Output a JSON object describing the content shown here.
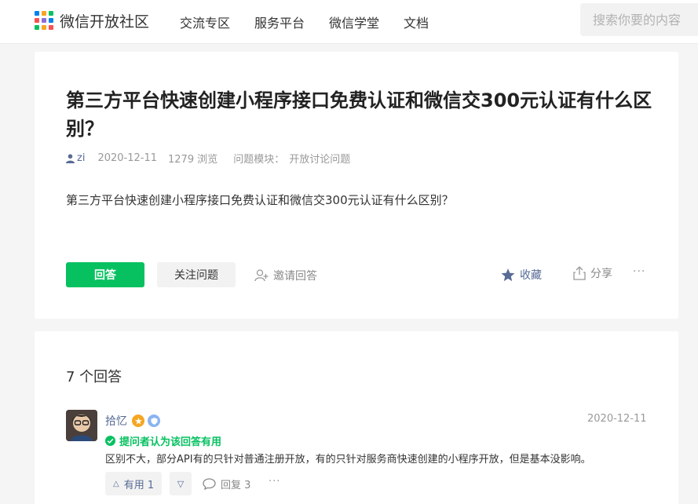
{
  "header": {
    "logo_text": "微信开放社区",
    "nav": [
      "交流专区",
      "服务平台",
      "微信学堂",
      "文档"
    ],
    "search_placeholder": "搜索你要的内容",
    "logo_colors": [
      "#0082ef",
      "#f5a623",
      "#07c160",
      "#fa5151",
      "#8a6dd9",
      "#0082ef",
      "#07c160",
      "#f5a623",
      "#fa5151"
    ]
  },
  "question": {
    "title": "第三方平台快速创建小程序接口免费认证和微信交300元认证有什么区别？",
    "author": "zi",
    "date": "2020-12-11",
    "views": "1279 浏览",
    "module_label": "问题模块：",
    "module_value": "开放讨论问题",
    "body": "第三方平台快速创建小程序接口免费认证和微信交300元认证有什么区别？",
    "answer_btn": "回答",
    "follow_btn": "关注问题",
    "invite": "邀请回答",
    "favorite": "收藏",
    "share": "分享",
    "more": "···"
  },
  "answers": {
    "count_label": "7 个回答",
    "items": [
      {
        "name": "拾忆",
        "date": "2020-12-11",
        "useful_tag": "提问者认为该回答有用",
        "text": "区别不大，部分API有的只针对普通注册开放，有的只针对服务商快速创建的小程序开放，但是基本没影响。",
        "useful_label": "有用 1",
        "reply_label": "回复 3",
        "more": "···"
      }
    ]
  },
  "colors": {
    "accent": "#07c160",
    "link": "#576b95"
  }
}
